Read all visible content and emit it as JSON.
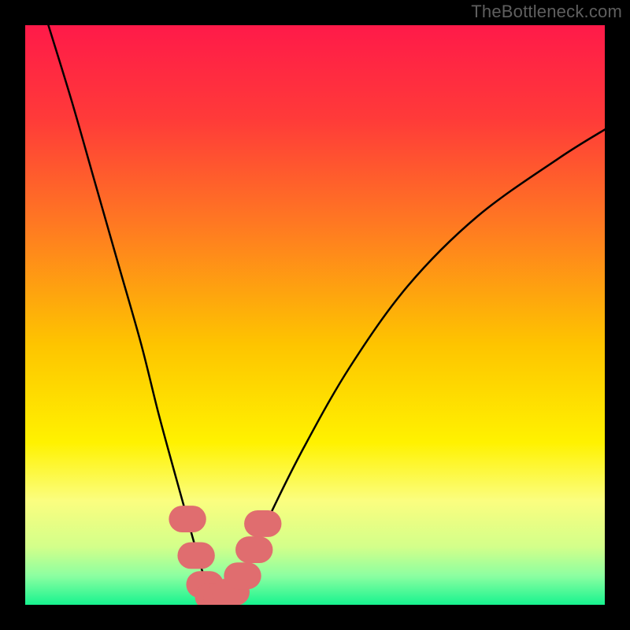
{
  "watermark": "TheBottleneck.com",
  "chart_data": {
    "type": "line",
    "title": "",
    "xlabel": "",
    "ylabel": "",
    "xlim": [
      0,
      100
    ],
    "ylim": [
      0,
      100
    ],
    "gradient_stops": [
      {
        "offset": 0.0,
        "color": "#ff1a49"
      },
      {
        "offset": 0.16,
        "color": "#ff3a39"
      },
      {
        "offset": 0.35,
        "color": "#ff7b21"
      },
      {
        "offset": 0.55,
        "color": "#fec400"
      },
      {
        "offset": 0.72,
        "color": "#fff200"
      },
      {
        "offset": 0.82,
        "color": "#fbfe7f"
      },
      {
        "offset": 0.9,
        "color": "#d3ff8a"
      },
      {
        "offset": 0.95,
        "color": "#8cffa1"
      },
      {
        "offset": 1.0,
        "color": "#17f38f"
      }
    ],
    "series": [
      {
        "name": "bottleneck-curve",
        "x": [
          4.0,
          8.0,
          12.0,
          16.0,
          20.0,
          23.0,
          26.0,
          28.5,
          30.5,
          32.0,
          33.5,
          35.5,
          38.0,
          42.0,
          48.0,
          56.0,
          66.0,
          78.0,
          92.0,
          100.0
        ],
        "y": [
          100.0,
          87.0,
          73.0,
          59.0,
          45.0,
          33.0,
          22.0,
          13.0,
          6.0,
          1.5,
          1.0,
          1.5,
          6.0,
          15.0,
          27.0,
          41.0,
          55.0,
          67.0,
          77.0,
          82.0
        ]
      }
    ],
    "markers": {
      "name": "highlight-band",
      "x": [
        28.0,
        29.5,
        31.0,
        32.5,
        34.0,
        35.5,
        37.5,
        39.5,
        41.0
      ],
      "y": [
        14.8,
        8.5,
        3.5,
        1.4,
        1.2,
        2.2,
        5.0,
        9.5,
        14.0
      ],
      "color": "#e06d6f",
      "radius": 2.3
    }
  }
}
